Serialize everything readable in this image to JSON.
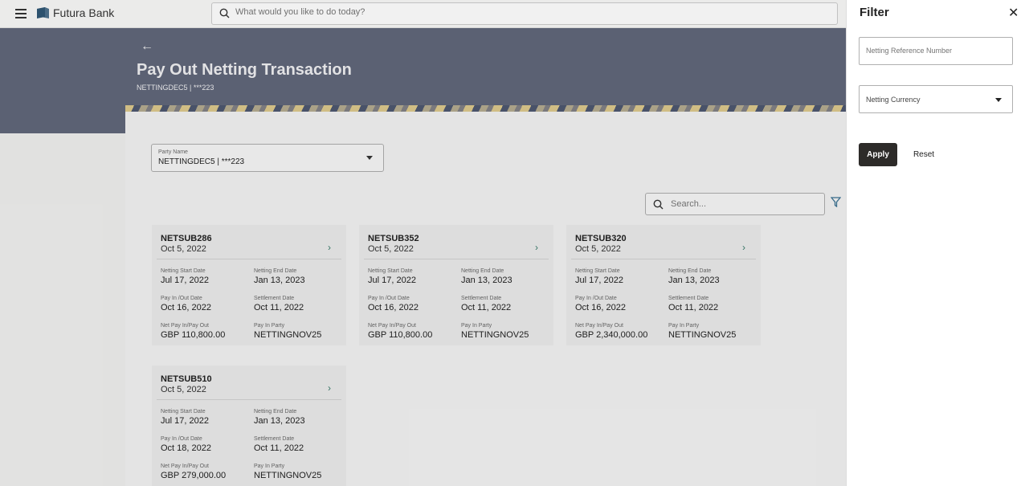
{
  "header": {
    "brand": "Futura Bank",
    "search_placeholder": "What would you like to do today?"
  },
  "page": {
    "back": "←",
    "title": "Pay Out Netting Transaction",
    "subtitle": "NETTINGDEC5 | ***223"
  },
  "party": {
    "label": "Party Name",
    "value": "NETTINGDEC5 | ***223"
  },
  "cards_search_placeholder": "Search...",
  "field_labels": {
    "start": "Netting Start Date",
    "end": "Netting End Date",
    "payinout": "Pay In /Out Date",
    "settlement": "Settlement Date",
    "net": "Net Pay In/Pay Out",
    "party": "Pay In Party"
  },
  "cards": [
    {
      "ref": "NETSUB286",
      "date": "Oct 5, 2022",
      "start": "Jul 17, 2022",
      "end": "Jan 13, 2023",
      "payinout": "Oct 16, 2022",
      "settlement": "Oct 11, 2022",
      "net": "GBP 110,800.00",
      "party": "NETTINGNOV25"
    },
    {
      "ref": "NETSUB352",
      "date": "Oct 5, 2022",
      "start": "Jul 17, 2022",
      "end": "Jan 13, 2023",
      "payinout": "Oct 16, 2022",
      "settlement": "Oct 11, 2022",
      "net": "GBP 110,800.00",
      "party": "NETTINGNOV25"
    },
    {
      "ref": "NETSUB320",
      "date": "Oct 5, 2022",
      "start": "Jul 17, 2022",
      "end": "Jan 13, 2023",
      "payinout": "Oct 16, 2022",
      "settlement": "Oct 11, 2022",
      "net": "GBP 2,340,000.00",
      "party": "NETTINGNOV25"
    },
    {
      "ref": "NETSUB510",
      "date": "Oct 5, 2022",
      "start": "Jul 17, 2022",
      "end": "Jan 13, 2023",
      "payinout": "Oct 18, 2022",
      "settlement": "Oct 11, 2022",
      "net": "GBP 279,000.00",
      "party": "NETTINGNOV25"
    }
  ],
  "filter": {
    "title": "Filter",
    "close": "✕",
    "ref_placeholder": "Netting Reference Number",
    "currency_label": "Netting Currency",
    "apply": "Apply",
    "reset": "Reset"
  },
  "colors": {
    "banner": "#5f6578",
    "apply_bg": "#2d2b29",
    "chevron": "#3a7a6a"
  }
}
